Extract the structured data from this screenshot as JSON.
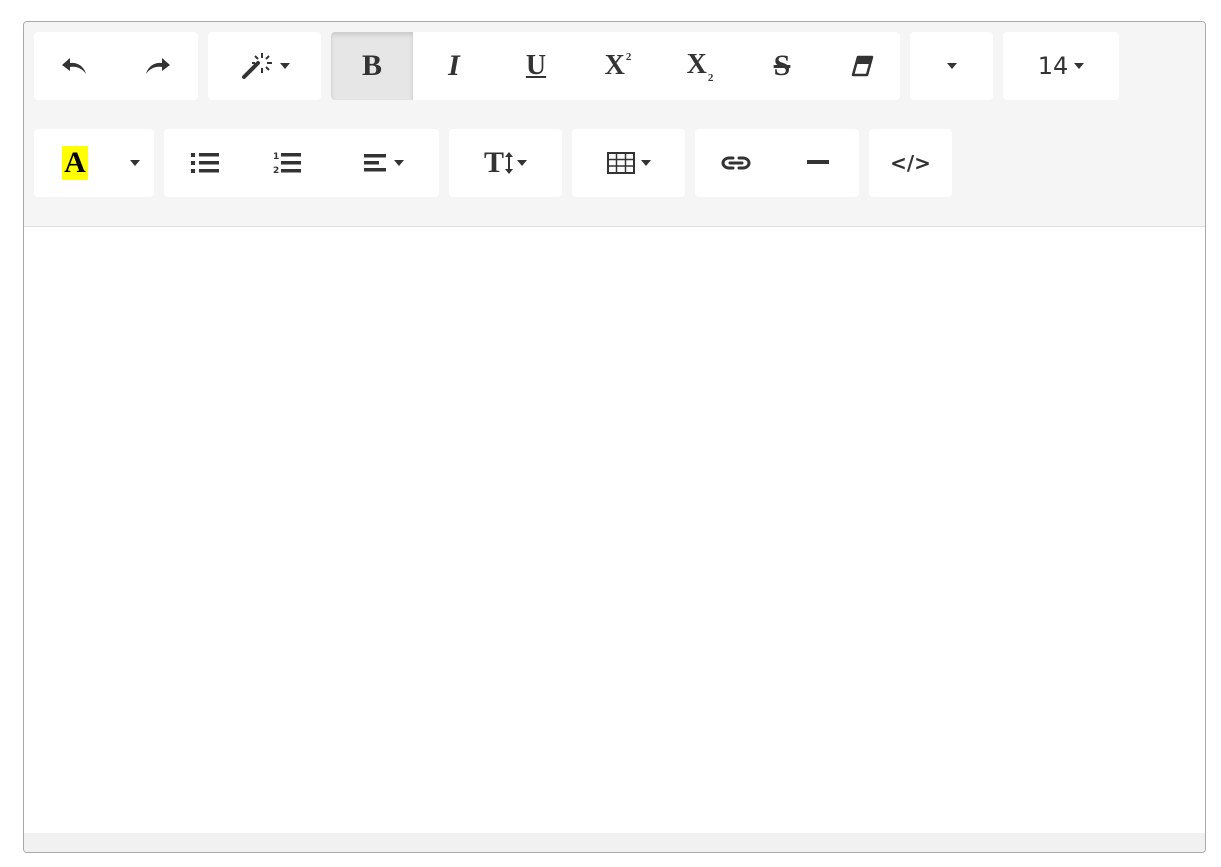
{
  "toolbar": {
    "font_size_label": "14",
    "bold_label": "B",
    "italic_label": "I",
    "underline_label": "U",
    "superscript_label": "X",
    "superscript_exponent": "2",
    "subscript_label": "X",
    "subscript_index": "2",
    "strikethrough_label": "S",
    "highlight_label": "A",
    "line_height_label": "T",
    "code_view_label": "</>"
  },
  "colors": {
    "highlight": "#ffff00",
    "toolbar_bg": "#f5f5f5",
    "icon": "#333333"
  },
  "icons": [
    "undo-icon",
    "redo-icon",
    "magic-wand-icon",
    "eraser-icon",
    "unordered-list-icon",
    "ordered-list-icon",
    "align-left-icon",
    "table-icon",
    "link-icon",
    "horizontal-rule-icon"
  ]
}
